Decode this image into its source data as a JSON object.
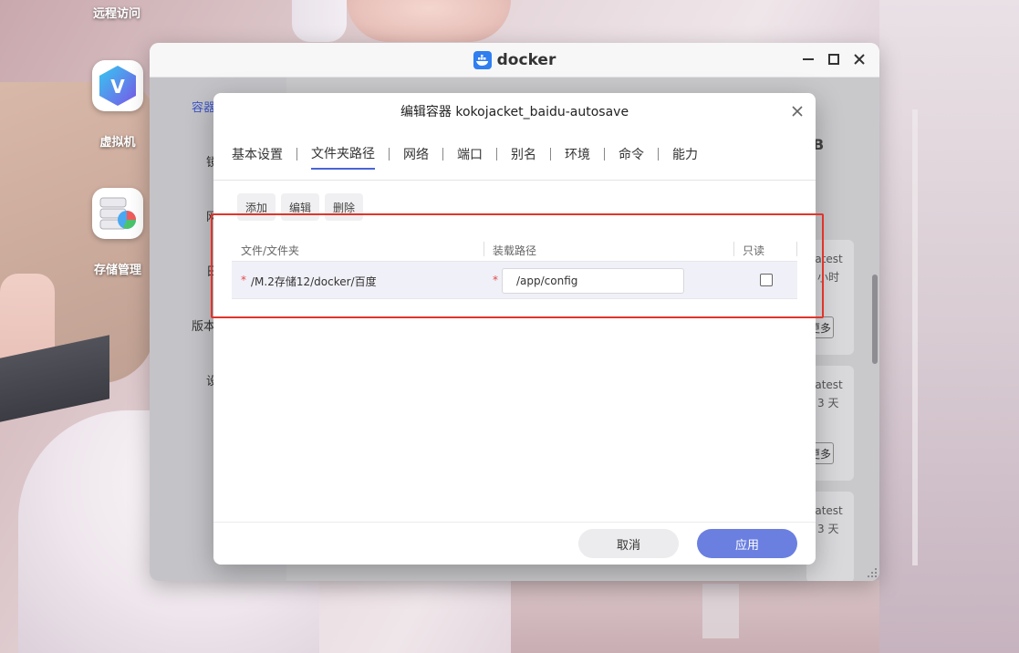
{
  "desktop": {
    "icons": [
      {
        "label": "远程访问"
      },
      {
        "label": "虚拟机",
        "glyph": "V"
      },
      {
        "label": "存储管理"
      }
    ]
  },
  "docker_window": {
    "title": "docker",
    "sidebar_fragments": [
      "容器",
      "镜",
      "网",
      "日",
      "版本",
      "设"
    ],
    "bg_fragments": {
      "size_b": "B",
      "card1_tag": "latest",
      "card1_time": "小时",
      "card2_tag": "latest",
      "card2_time": "3 天",
      "card3_tag": "latest",
      "card3_time": "3 天",
      "more": "更多"
    }
  },
  "modal": {
    "title": "编辑容器 kokojacket_baidu-autosave",
    "tabs": [
      "基本设置",
      "文件夹路径",
      "网络",
      "端口",
      "别名",
      "环境",
      "命令",
      "能力"
    ],
    "active_tab_index": 1,
    "toolbar": {
      "add": "添加",
      "edit": "编辑",
      "delete": "删除"
    },
    "table": {
      "headers": [
        "文件/文件夹",
        "装载路径",
        "只读"
      ],
      "rows": [
        {
          "required_mark": "*",
          "host_path": "/M.2存储12/docker/百度",
          "mount_path": "/app/config",
          "readonly": false
        }
      ]
    },
    "cancel_label": "取消",
    "apply_label": "应用"
  },
  "colors": {
    "accent": "#4a64d8",
    "apply": "#6a7fe0",
    "highlight": "#e0352b",
    "required": "#e14a4a"
  }
}
